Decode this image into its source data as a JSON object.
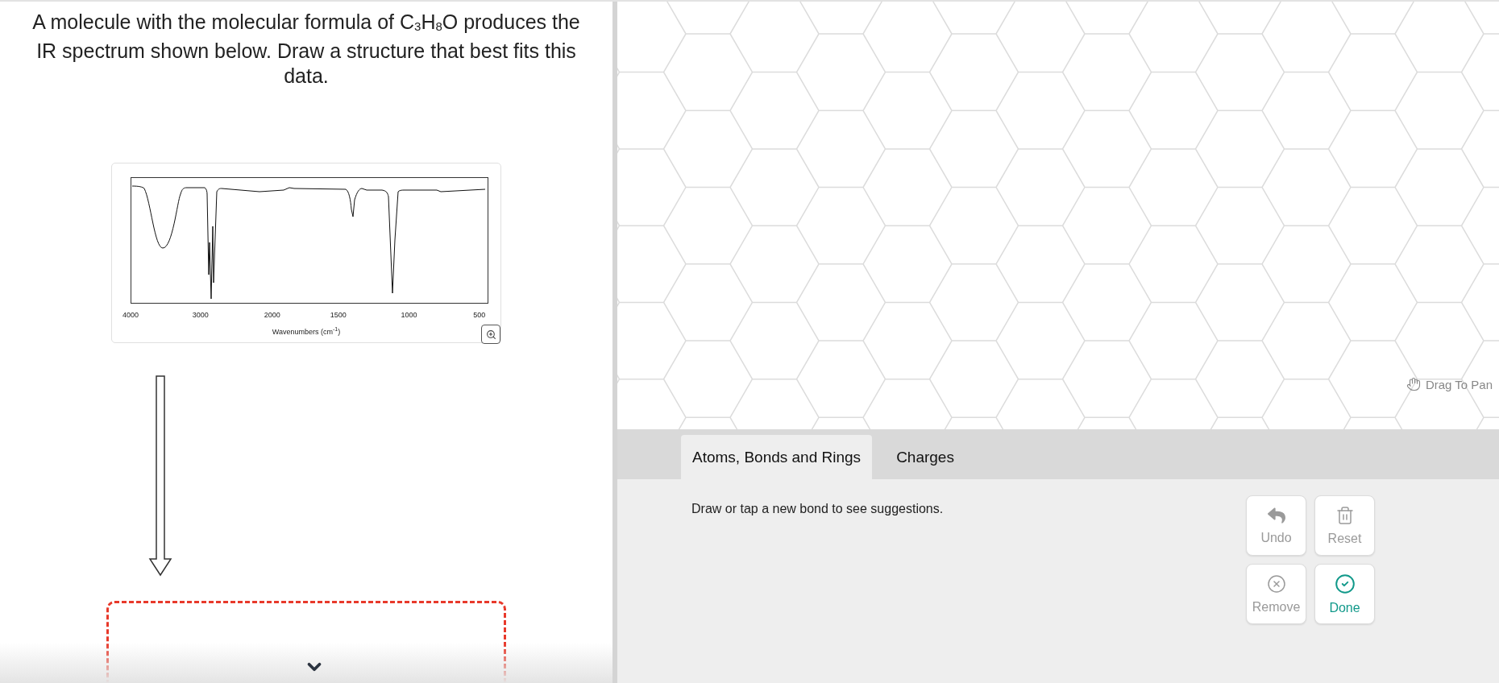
{
  "question": "A molecule with the molecular formula of C$_{3}$H$_{8}$O produces the IR spectrum shown below. Draw a structure that best fits this data.",
  "spectrum": {
    "xticks": [
      "4000",
      "3000",
      "2000",
      "1500",
      "1000",
      "500"
    ],
    "xlabel": "Wavenumbers (cm$^{-1}$)"
  },
  "canvas": {
    "hint": "Drag To Pan"
  },
  "tabs": [
    {
      "label": "Atoms, Bonds and Rings",
      "selected": true
    },
    {
      "label": "Charges",
      "selected": false
    }
  ],
  "message": "Draw or tap a new bond to see suggestions.",
  "buttons": [
    {
      "kind": "undo",
      "label": "Undo",
      "disabled": true
    },
    {
      "kind": "reset",
      "label": "Reset",
      "disabled": true
    },
    {
      "kind": "remove",
      "label": "Remove",
      "disabled": true
    },
    {
      "kind": "done",
      "label": "Done",
      "disabled": false
    }
  ]
}
